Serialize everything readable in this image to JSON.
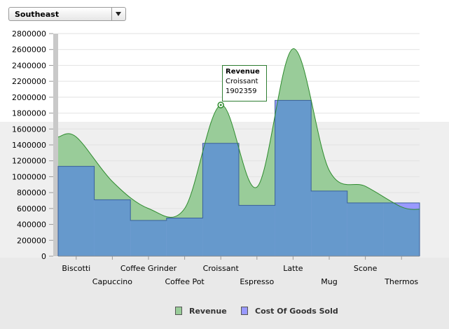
{
  "region_filter": {
    "selected": "Southeast"
  },
  "tooltip": {
    "series": "Revenue",
    "category": "Croissant",
    "value": "1902359"
  },
  "colors": {
    "revenue": "#99cc99",
    "revenue_stroke": "#2e8b2e",
    "cogs": "#9999ff",
    "overlap": "#6699cc",
    "overlap_stroke": "#3a5f9a"
  },
  "chart_data": {
    "type": "area",
    "categories": [
      "Biscotti",
      "Capuccino",
      "Coffee Grinder",
      "Coffee Pot",
      "Croissant",
      "Espresso",
      "Latte",
      "Mug",
      "Scone",
      "Thermos"
    ],
    "ylim": [
      0,
      2800000
    ],
    "yticks": [
      "0",
      "200000",
      "400000",
      "600000",
      "800000",
      "1000000",
      "1200000",
      "1400000",
      "1600000",
      "1800000",
      "2000000",
      "2200000",
      "2400000",
      "2600000",
      "2800000"
    ],
    "legend_position": "bottom",
    "series": [
      {
        "name": "Revenue",
        "style": "smooth-area",
        "values": [
          1500000,
          940000,
          600000,
          600000,
          1902359,
          870000,
          2610000,
          1080000,
          880000,
          620000
        ]
      },
      {
        "name": "Cost Of Goods Sold",
        "style": "step",
        "values": [
          1130000,
          710000,
          450000,
          480000,
          1420000,
          640000,
          1960000,
          820000,
          670000,
          670000
        ]
      }
    ]
  }
}
